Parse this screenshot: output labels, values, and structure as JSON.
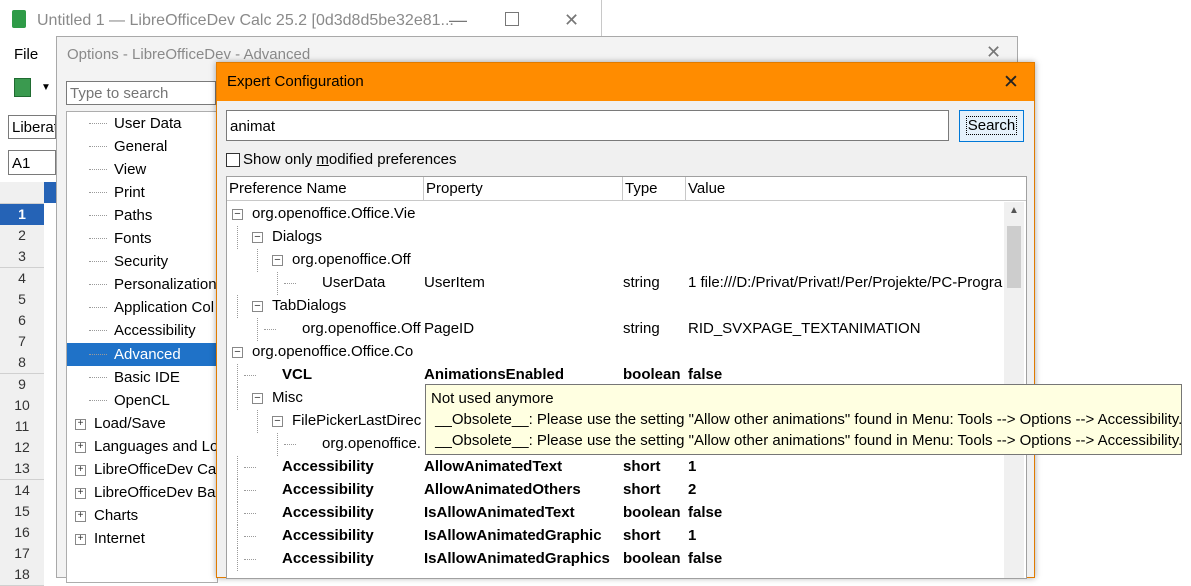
{
  "calc": {
    "title": "Untitled 1 — LibreOfficeDev Calc 25.2 [0d3d8d5be32e81...",
    "menu_file": "File",
    "font_box": "Liberat",
    "name_box": "A1",
    "rows": [
      "1",
      "2",
      "3",
      "4",
      "5",
      "6",
      "7",
      "8",
      "9",
      "10",
      "11",
      "12",
      "13",
      "14",
      "15",
      "16",
      "17",
      "18"
    ]
  },
  "options": {
    "title": "Options - LibreOfficeDev - Advanced",
    "search_placeholder": "Type to search",
    "tree": [
      {
        "label": "User Data",
        "level": 1
      },
      {
        "label": "General",
        "level": 1
      },
      {
        "label": "View",
        "level": 1
      },
      {
        "label": "Print",
        "level": 1
      },
      {
        "label": "Paths",
        "level": 1
      },
      {
        "label": "Fonts",
        "level": 1
      },
      {
        "label": "Security",
        "level": 1
      },
      {
        "label": "Personalization",
        "level": 1
      },
      {
        "label": "Application Col",
        "level": 1
      },
      {
        "label": "Accessibility",
        "level": 1
      },
      {
        "label": "Advanced",
        "level": 1,
        "selected": true
      },
      {
        "label": "Basic IDE",
        "level": 1
      },
      {
        "label": "OpenCL",
        "level": 1
      },
      {
        "label": "Load/Save",
        "level": 0
      },
      {
        "label": "Languages and Loc",
        "level": 0
      },
      {
        "label": "LibreOfficeDev Cal",
        "level": 0
      },
      {
        "label": "LibreOfficeDev Bas",
        "level": 0
      },
      {
        "label": "Charts",
        "level": 0
      },
      {
        "label": "Internet",
        "level": 0
      }
    ]
  },
  "expert": {
    "title": "Expert Configuration",
    "search_value": "animat",
    "search_button": "Search",
    "checkbox_label": "Show only modified preferences",
    "columns": [
      "Preference Name",
      "Property",
      "Type",
      "Value"
    ],
    "rows": [
      {
        "name": "org.openoffice.Office.Vie",
        "property": "",
        "type": "",
        "value": "",
        "level": 0,
        "toggle": "minus",
        "bold": false
      },
      {
        "name": "Dialogs",
        "property": "",
        "type": "",
        "value": "",
        "level": 1,
        "toggle": "minus",
        "bold": false
      },
      {
        "name": "org.openoffice.Off",
        "property": "",
        "type": "",
        "value": "",
        "level": 2,
        "toggle": "minus",
        "bold": false
      },
      {
        "name": "UserData",
        "property": "UserItem",
        "type": "string",
        "value": "1 file:///D:/Privat/Privat!/Per/Projekte/PC-Progra",
        "level": 3,
        "toggle": "",
        "bold": false
      },
      {
        "name": "TabDialogs",
        "property": "",
        "type": "",
        "value": "",
        "level": 1,
        "toggle": "minus",
        "bold": false
      },
      {
        "name": "org.openoffice.Off",
        "property": "PageID",
        "type": "string",
        "value": "RID_SVXPAGE_TEXTANIMATION",
        "level": 2,
        "toggle": "",
        "bold": false
      },
      {
        "name": "org.openoffice.Office.Co",
        "property": "",
        "type": "",
        "value": "",
        "level": 0,
        "toggle": "minus",
        "bold": false
      },
      {
        "name": "VCL",
        "property": "AnimationsEnabled",
        "type": "boolean",
        "value": "false",
        "level": 1,
        "toggle": "",
        "bold": true
      },
      {
        "name": "Misc",
        "property": "",
        "type": "",
        "value": "",
        "level": 1,
        "toggle": "minus",
        "bold": false
      },
      {
        "name": "FilePickerLastDirec",
        "property": "",
        "type": "",
        "value": "",
        "level": 2,
        "toggle": "minus",
        "bold": false
      },
      {
        "name": "org.openoffice.",
        "property": "",
        "type": "",
        "value": "",
        "level": 3,
        "toggle": "",
        "bold": false
      },
      {
        "name": "Accessibility",
        "property": "AllowAnimatedText",
        "type": "short",
        "value": "1",
        "level": 1,
        "toggle": "",
        "bold": true
      },
      {
        "name": "Accessibility",
        "property": "AllowAnimatedOthers",
        "type": "short",
        "value": "2",
        "level": 1,
        "toggle": "",
        "bold": true
      },
      {
        "name": "Accessibility",
        "property": "IsAllowAnimatedText",
        "type": "boolean",
        "value": "false",
        "level": 1,
        "toggle": "",
        "bold": true
      },
      {
        "name": "Accessibility",
        "property": "IsAllowAnimatedGraphic",
        "type": "short",
        "value": "1",
        "level": 1,
        "toggle": "",
        "bold": true
      },
      {
        "name": "Accessibility",
        "property": "IsAllowAnimatedGraphics",
        "type": "boolean",
        "value": "false",
        "level": 1,
        "toggle": "",
        "bold": true
      }
    ],
    "tooltip": {
      "line1": "Not used anymore",
      "line2": " __Obsolete__: Please use the setting \"Allow other animations\" found in Menu: Tools --> Options --> Accessibility.",
      "line3": " __Obsolete__: Please use the setting \"Allow other animations\" found in Menu: Tools --> Options --> Accessibility."
    }
  },
  "colors": {
    "accent": "#ff8c00",
    "selection": "#1f72c8",
    "tooltip_bg": "#ffffe1"
  }
}
